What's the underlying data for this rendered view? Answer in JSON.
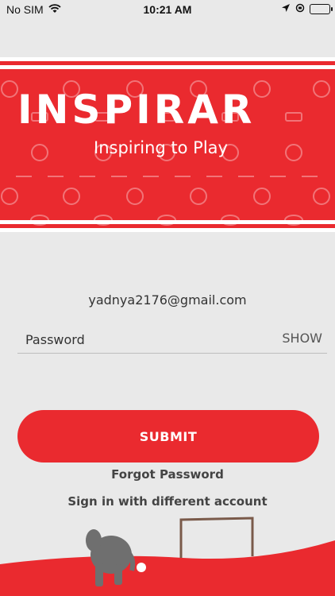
{
  "status_bar": {
    "carrier": "No SIM",
    "time": "10:21 AM"
  },
  "banner": {
    "logo_text": "INSPIRAR",
    "tagline": "Inspiring to Play"
  },
  "form": {
    "email": "yadnya2176@gmail.com",
    "password_placeholder": "Password",
    "show_label": "SHOW",
    "submit_label": "SUBMIT",
    "forgot_label": "Forgot Password",
    "switch_label": "Sign in with different account"
  },
  "colors": {
    "brand": "#ea2a2f",
    "background": "#e9e9e9"
  }
}
